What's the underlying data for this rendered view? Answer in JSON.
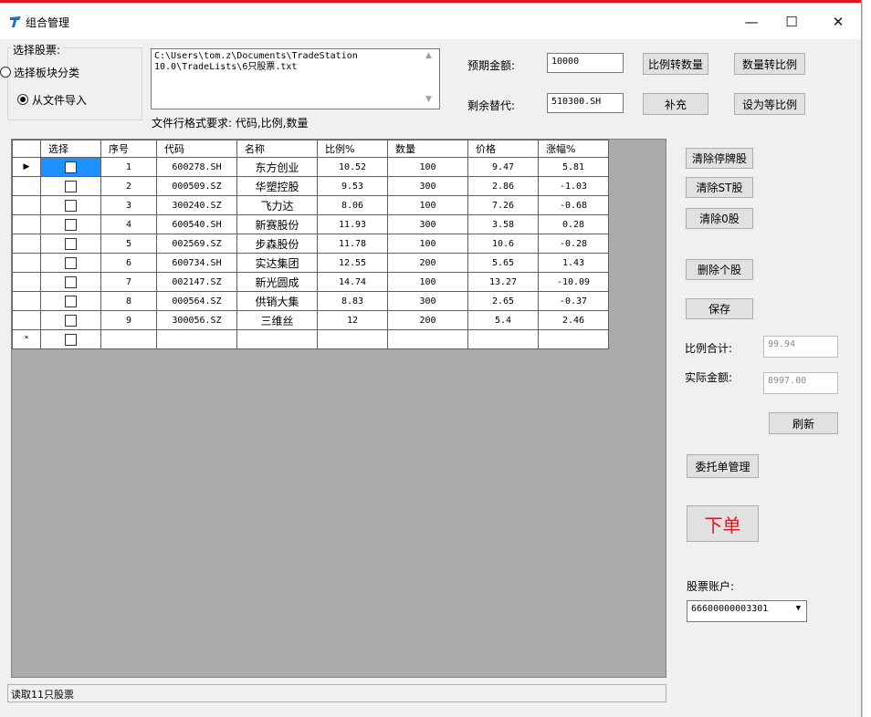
{
  "window": {
    "title": "组合管理",
    "controls": {
      "minimize": "—",
      "maximize": "☐",
      "close": "✕"
    }
  },
  "stock_select": {
    "legend": "选择股票:",
    "options": [
      {
        "label": "选择板块分类",
        "checked": false
      },
      {
        "label": "从文件导入",
        "checked": true
      }
    ]
  },
  "file_path": "C:\\Users\\tom.z\\Documents\\TradeStation 10.0\\TradeLists\\6只股票.txt",
  "file_format_hint": "文件行格式要求: 代码,比例,数量",
  "expected_amount": {
    "label": "预期金额:",
    "value": "10000"
  },
  "substitute": {
    "label": "剩余替代:",
    "value": "510300.SH"
  },
  "buttons": {
    "ratio_to_qty": "比例转数量",
    "qty_to_ratio": "数量转比例",
    "supplement": "补充",
    "set_equal_ratio": "设为等比例",
    "clear_suspended": "清除停牌股",
    "clear_st": "清除ST股",
    "clear_zero": "清除0股",
    "delete_stock": "删除个股",
    "save": "保存",
    "refresh": "刷新",
    "order_management": "委托单管理",
    "place_order": "下单"
  },
  "table": {
    "columns": [
      "选择",
      "序号",
      "代码",
      "名称",
      "比例%",
      "数量",
      "价格",
      "涨幅%"
    ],
    "rows": [
      {
        "seq": "1",
        "code": "600278.SH",
        "name": "东方创业",
        "ratio": "10.52",
        "qty": "100",
        "price": "9.47",
        "change": "5.81"
      },
      {
        "seq": "2",
        "code": "000509.SZ",
        "name": "华塑控股",
        "ratio": "9.53",
        "qty": "300",
        "price": "2.86",
        "change": "-1.03"
      },
      {
        "seq": "3",
        "code": "300240.SZ",
        "name": "飞力达",
        "ratio": "8.06",
        "qty": "100",
        "price": "7.26",
        "change": "-0.68"
      },
      {
        "seq": "4",
        "code": "600540.SH",
        "name": "新赛股份",
        "ratio": "11.93",
        "qty": "300",
        "price": "3.58",
        "change": "0.28"
      },
      {
        "seq": "5",
        "code": "002569.SZ",
        "name": "步森股份",
        "ratio": "11.78",
        "qty": "100",
        "price": "10.6",
        "change": "-0.28"
      },
      {
        "seq": "6",
        "code": "600734.SH",
        "name": "实达集团",
        "ratio": "12.55",
        "qty": "200",
        "price": "5.65",
        "change": "1.43"
      },
      {
        "seq": "7",
        "code": "002147.SZ",
        "name": "新光圆成",
        "ratio": "14.74",
        "qty": "100",
        "price": "13.27",
        "change": "-10.09"
      },
      {
        "seq": "8",
        "code": "000564.SZ",
        "name": "供销大集",
        "ratio": "8.83",
        "qty": "300",
        "price": "2.65",
        "change": "-0.37"
      },
      {
        "seq": "9",
        "code": "300056.SZ",
        "name": "三维丝",
        "ratio": "12",
        "qty": "200",
        "price": "5.4",
        "change": "2.46"
      }
    ],
    "current_row_marker": "▶",
    "new_row_marker": "*"
  },
  "ratio_total": {
    "label": "比例合计:",
    "value": "99.94"
  },
  "actual_amount": {
    "label": "实际金额:",
    "value": "8997.00"
  },
  "account": {
    "label": "股票账户:",
    "value": "66600000003301"
  },
  "status_text": "读取11只股票",
  "colors": {
    "accent_red": "#e81123",
    "order_button_text": "#e0141e",
    "logo_blue": "#1c6fc4"
  }
}
